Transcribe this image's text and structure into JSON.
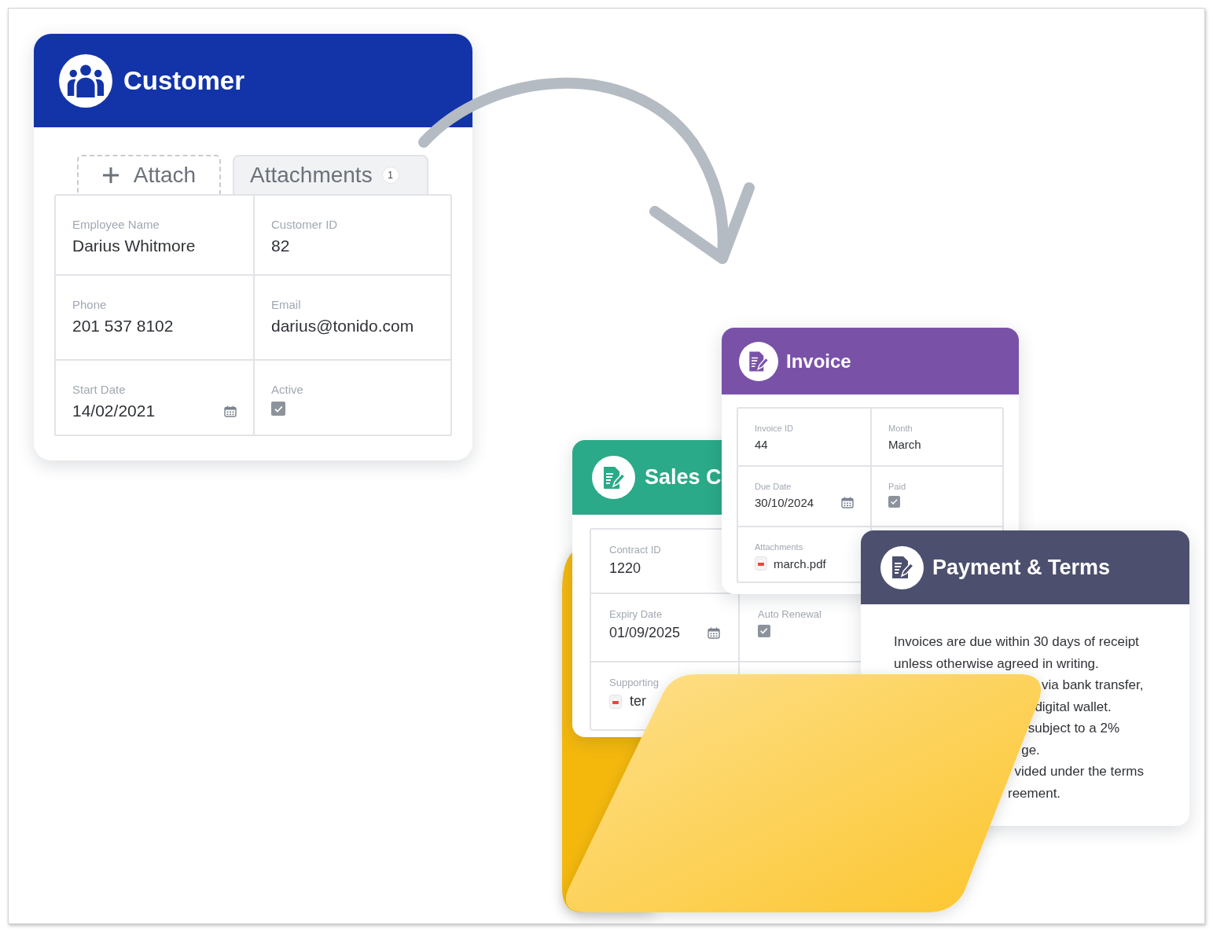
{
  "customer_card": {
    "title": "Customer",
    "tabs": [
      {
        "kind": "add",
        "label": "Attach"
      },
      {
        "kind": "list",
        "label": "Attachments",
        "count": "1"
      }
    ],
    "rows": [
      [
        {
          "kind": "text",
          "label": "Employee Name",
          "value": "Darius Whitmore"
        },
        {
          "kind": "text",
          "label": "Customer ID",
          "value": "82"
        }
      ],
      [
        {
          "kind": "text",
          "label": "Phone",
          "value": "201 537 8102"
        },
        {
          "kind": "text",
          "label": "Email",
          "value": "darius@tonido.com"
        }
      ],
      [
        {
          "kind": "date",
          "label": "Start Date",
          "value": "14/02/2021"
        },
        {
          "kind": "checkbox",
          "label": "Active",
          "checked": true
        }
      ]
    ]
  },
  "sales_contract_card": {
    "title": "Sales C",
    "rows": [
      [
        {
          "kind": "text",
          "label": "Contract ID",
          "value": "1220"
        }
      ],
      [
        {
          "kind": "date",
          "label": "Expiry Date",
          "value": "01/09/2025"
        },
        {
          "kind": "checkbox",
          "label": "Auto Renewal",
          "checked": true
        }
      ],
      [
        {
          "kind": "file",
          "label": "Supporting",
          "value": "ter"
        }
      ]
    ]
  },
  "invoice_card": {
    "title": "Invoice",
    "rows": [
      [
        {
          "kind": "text",
          "label": "Invoice ID",
          "value": "44"
        },
        {
          "kind": "text",
          "label": "Month",
          "value": "March"
        }
      ],
      [
        {
          "kind": "date",
          "label": "Due Date",
          "value": "30/10/2024"
        },
        {
          "kind": "checkbox",
          "label": "Paid",
          "checked": true
        }
      ],
      [
        {
          "kind": "file",
          "label": "Attachments",
          "value": "march.pdf"
        }
      ]
    ]
  },
  "payment_terms_card": {
    "title": "Payment & Terms",
    "lines": [
      {
        "kind": "full",
        "text": "Invoices are due within 30 days of receipt"
      },
      {
        "kind": "full",
        "text": "unless otherwise agreed in writing."
      },
      {
        "kind": "cut",
        "text": "via bank transfer,"
      },
      {
        "kind": "cut",
        "text": "digital wallet."
      },
      {
        "kind": "cut",
        "text": "subject to a 2%"
      },
      {
        "kind": "cut",
        "text": "ge."
      },
      {
        "kind": "cut",
        "text": "vided under the terms"
      },
      {
        "kind": "cut",
        "text": "reement."
      }
    ]
  }
}
